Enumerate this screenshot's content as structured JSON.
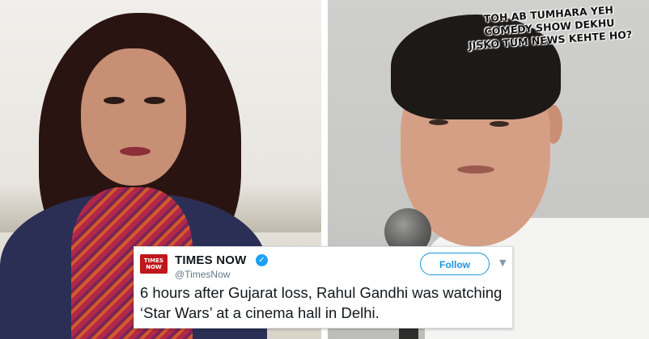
{
  "caption": {
    "lines": [
      "TOH AB TUMHARA YEH",
      "COMEDY SHOW DEKHU",
      "JISKO TUM NEWS KEHTE HO?"
    ]
  },
  "tweet": {
    "logo_top": "TIMES",
    "logo_bottom": "NOW",
    "account_name": "TIMES NOW",
    "handle": "@TimesNow",
    "follow_label": "Follow",
    "text": "6 hours after Gujarat loss, Rahul Gandhi was watching ‘Star Wars’ at a cinema hall in Delhi."
  },
  "colors": {
    "follow_blue": "#1b95e0",
    "verified_blue": "#1da1f2",
    "logo_red": "#c0161c"
  },
  "icons": {
    "verified": "verified-badge-icon",
    "chevron": "chevron-down-icon"
  }
}
